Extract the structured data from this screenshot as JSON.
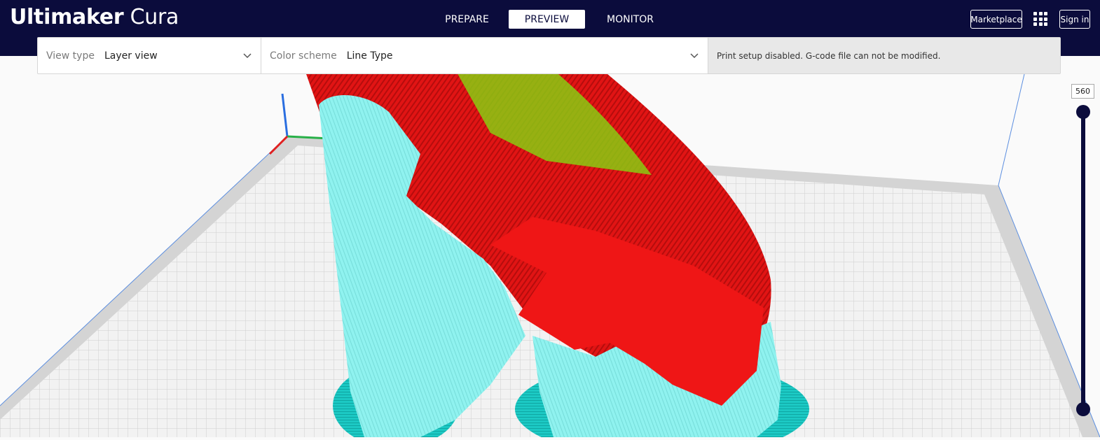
{
  "app": {
    "name_bold": "Ultimaker",
    "name_light": "Cura"
  },
  "stages": [
    {
      "label": "PREPARE",
      "active": false
    },
    {
      "label": "PREVIEW",
      "active": true
    },
    {
      "label": "MONITOR",
      "active": false
    }
  ],
  "header": {
    "marketplace_label": "Marketplace",
    "signin_label": "Sign in",
    "apps_icon": "grid-icon"
  },
  "viewbar": {
    "view_type_label": "View type",
    "view_type_value": "Layer view",
    "color_scheme_label": "Color scheme",
    "color_scheme_value": "Line Type",
    "message": "Print setup disabled. G-code file can not be modified."
  },
  "layer_slider": {
    "current_layer": "560",
    "max_layer_fraction": 1.0,
    "min_layer_fraction": 0.0
  },
  "colors": {
    "topbar": "#0b0c3c",
    "model_outer_wall": "#ff1a1a",
    "model_support": "#86f0ee",
    "model_skirt": "#19c6c2",
    "inner_wall": "#7ec800",
    "build_plate": "#ececec"
  }
}
